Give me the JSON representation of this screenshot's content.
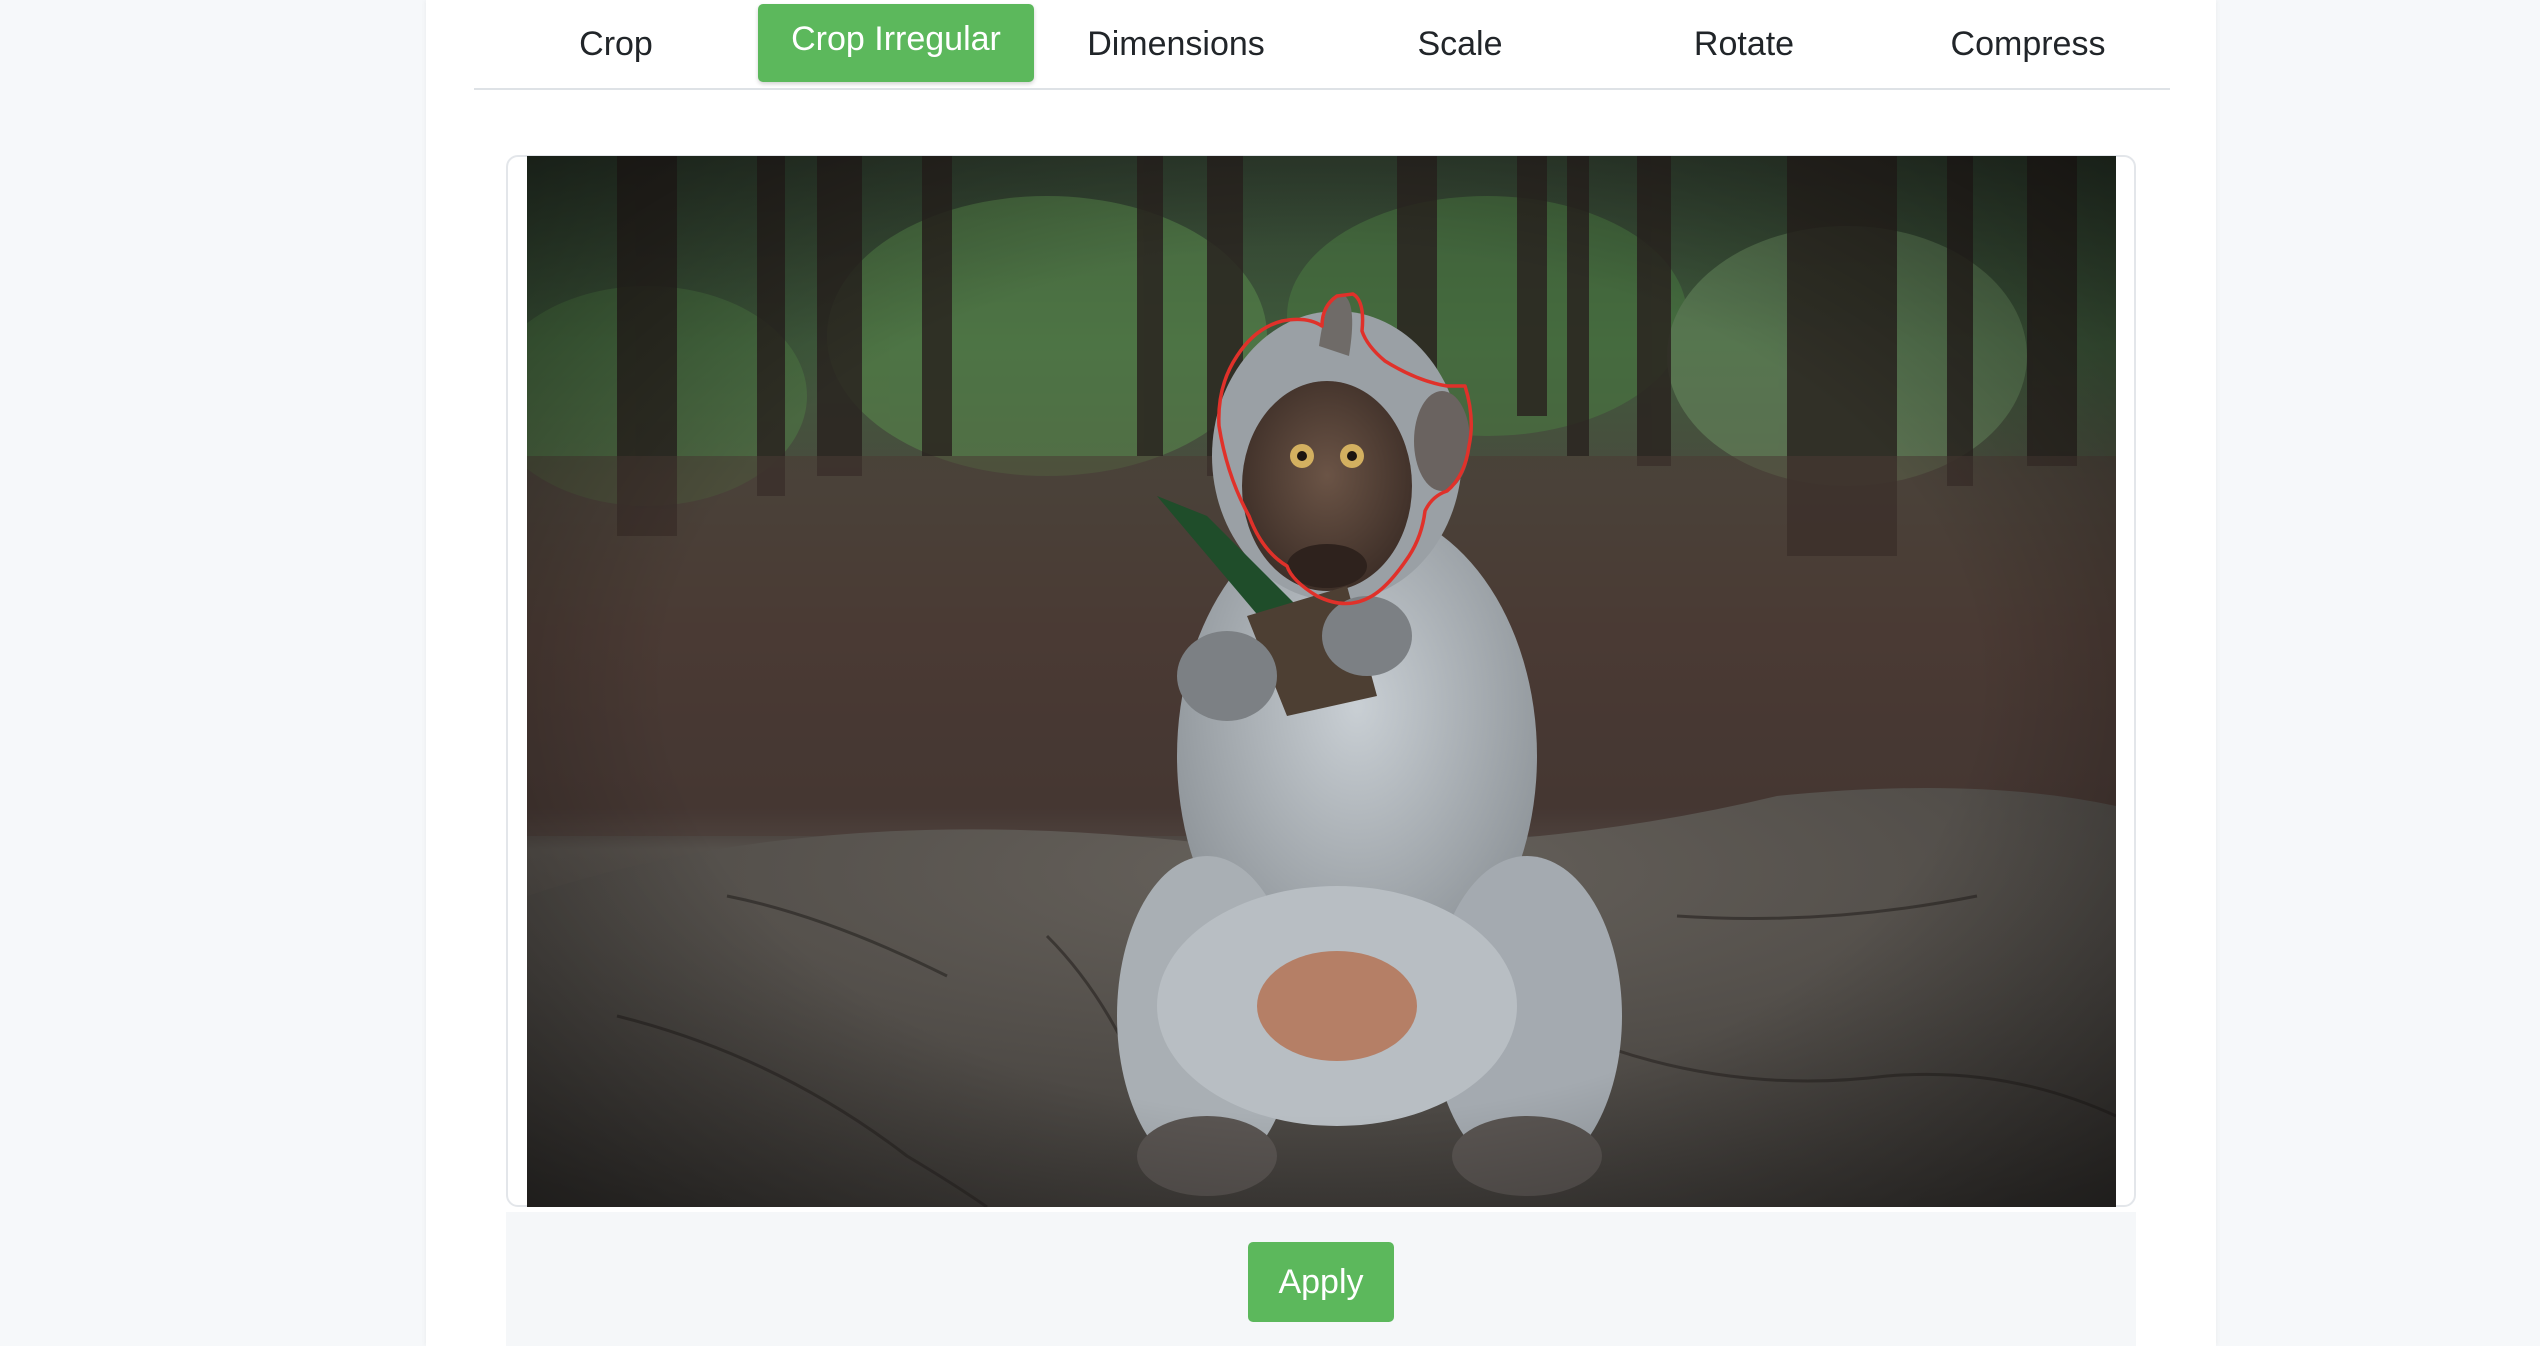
{
  "tabs": [
    {
      "label": "Crop",
      "active": false
    },
    {
      "label": "Crop Irregular",
      "active": true
    },
    {
      "label": "Dimensions",
      "active": false
    },
    {
      "label": "Scale",
      "active": false
    },
    {
      "label": "Rotate",
      "active": false
    },
    {
      "label": "Compress",
      "active": false
    }
  ],
  "colors": {
    "accent": "#5cb85c",
    "selection_outline": "#e0312a"
  },
  "image": {
    "subject": "macaque monkey sitting on rock holding leaf in forest"
  },
  "apply_label": "Apply"
}
